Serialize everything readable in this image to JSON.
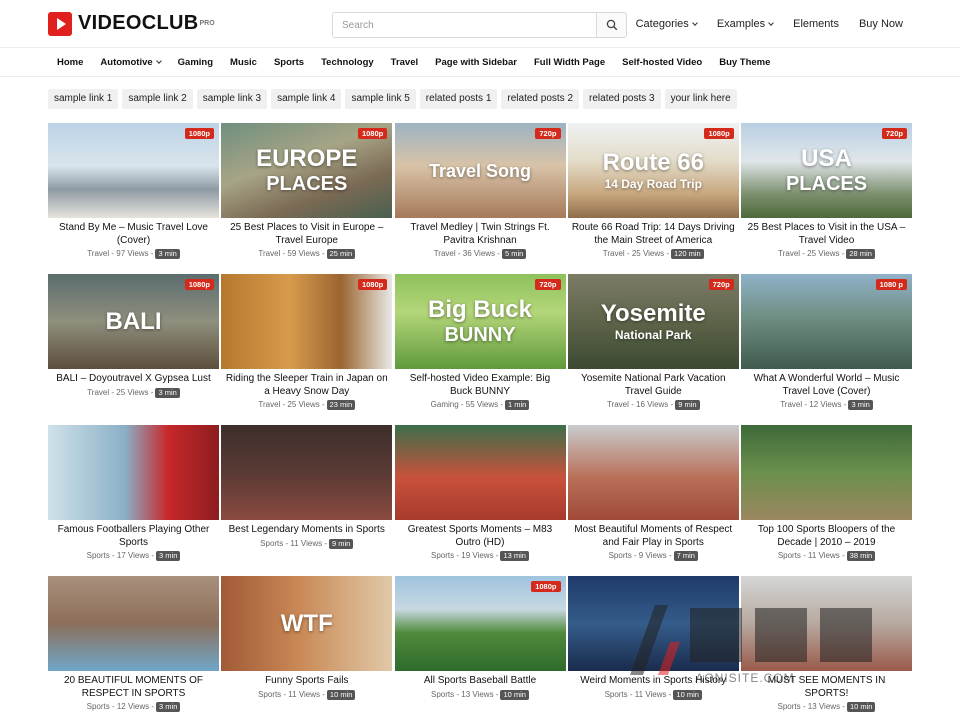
{
  "header": {
    "brand": "VIDEOCLUB",
    "brand_badge": "PRO",
    "search_placeholder": "Search",
    "menu": [
      {
        "label": "Categories",
        "dropdown": true
      },
      {
        "label": "Examples",
        "dropdown": true
      },
      {
        "label": "Elements",
        "dropdown": false
      },
      {
        "label": "Buy Now",
        "dropdown": false
      }
    ]
  },
  "nav": [
    {
      "label": "Home",
      "dropdown": false
    },
    {
      "label": "Automotive",
      "dropdown": true
    },
    {
      "label": "Gaming",
      "dropdown": false
    },
    {
      "label": "Music",
      "dropdown": false
    },
    {
      "label": "Sports",
      "dropdown": false
    },
    {
      "label": "Technology",
      "dropdown": false
    },
    {
      "label": "Travel",
      "dropdown": false
    },
    {
      "label": "Page with Sidebar",
      "dropdown": false
    },
    {
      "label": "Full Width Page",
      "dropdown": false
    },
    {
      "label": "Self-hosted Video",
      "dropdown": false
    },
    {
      "label": "Buy Theme",
      "dropdown": false
    }
  ],
  "tags": [
    "sample link 1",
    "sample link 2",
    "sample link 3",
    "sample link 4",
    "sample link 5",
    "related posts 1",
    "related posts 2",
    "related posts 3",
    "your link here"
  ],
  "videos": [
    {
      "title": "Stand By Me – Music Travel Love (Cover)",
      "meta": "Travel - 97 Views -",
      "duration": "3 min",
      "quality": "1080p",
      "thumb_text": "",
      "thumb_sub": "",
      "bg": "linear-gradient(180deg,#bcd3e6 0%,#d9e4ec 45%,#8e9aa3 70%,#e7e3dd 100%)"
    },
    {
      "title": "25 Best Places to Visit in Europe – Travel Europe",
      "meta": "Travel - 59 Views -",
      "duration": "25 min",
      "quality": "1080p",
      "thumb_text": "EUROPE",
      "thumb_sub": "PLACES",
      "bg": "linear-gradient(160deg,#6f8f7e 0%,#a7a486 40%,#7b6a54 70%,#48604f 100%)"
    },
    {
      "title": "Travel Medley | Twin Strings Ft. Pavitra Krishnan",
      "meta": "Travel - 36 Views -",
      "duration": "5 min",
      "quality": "720p",
      "thumb_text": "Travel Song",
      "thumb_sub": "",
      "bg": "linear-gradient(180deg,#9cb3c2 0%,#d8c3a8 45%,#a6795a 100%)"
    },
    {
      "title": "Route 66 Road Trip: 14 Days Driving the Main Street of America",
      "meta": "Travel - 25 Views -",
      "duration": "120 min",
      "quality": "1080p",
      "thumb_text": "Route 66",
      "thumb_sub": "14 Day Road Trip",
      "bg": "linear-gradient(180deg,#eef1f3 0%,#e3dcc9 40%,#c7a67d 75%,#8f6d4c 100%)"
    },
    {
      "title": "25 Best Places to Visit in the USA – Travel Video",
      "meta": "Travel - 25 Views -",
      "duration": "28 min",
      "quality": "720p",
      "thumb_text": "USA",
      "thumb_sub": "PLACES",
      "bg": "linear-gradient(180deg,#b8cfe3 0%,#e0e6ea 40%,#7c8f6e 75%,#4c6a3a 100%)"
    },
    {
      "title": "BALI – Doyoutravel X Gypsea Lust",
      "meta": "Travel - 25 Views -",
      "duration": "3 min",
      "quality": "1080p",
      "thumb_text": "BALI",
      "thumb_sub": "",
      "bg": "linear-gradient(180deg,#5b6d6e 0%,#8f8f7d 50%,#5c4e3d 100%)"
    },
    {
      "title": "Riding the Sleeper Train in Japan on a Heavy Snow Day",
      "meta": "Travel - 25 Views -",
      "duration": "23 min",
      "quality": "1080p",
      "thumb_text": "",
      "thumb_sub": "",
      "bg": "linear-gradient(90deg,#b5782d 0%,#d89b4d 40%,#9c6530 70%,#e8e8e6 100%)"
    },
    {
      "title": "Self-hosted Video Example: Big Buck BUNNY",
      "meta": "Gaming - 55 Views -",
      "duration": "1 min",
      "quality": "720p",
      "thumb_text": "Big Buck",
      "thumb_sub": "BUNNY",
      "bg": "linear-gradient(180deg,#8dc15b 0%,#b4d67a 40%,#5f9a3a 100%)"
    },
    {
      "title": "Yosemite National Park Vacation Travel Guide",
      "meta": "Travel - 16 Views -",
      "duration": "9 min",
      "quality": "720p",
      "thumb_text": "Yosemite",
      "thumb_sub": "National Park",
      "bg": "linear-gradient(180deg,#7d7b66 0%,#5d6449 50%,#3c4a32 100%)"
    },
    {
      "title": "What A Wonderful World – Music Travel Love (Cover)",
      "meta": "Travel - 12 Views -",
      "duration": "3 min",
      "quality": "1080 p",
      "thumb_text": "",
      "thumb_sub": "",
      "bg": "linear-gradient(180deg,#8fb2c9 0%,#6f8f82 45%,#3f5b4d 100%)"
    },
    {
      "title": "Famous Footballers Playing Other Sports",
      "meta": "Sports - 17 Views -",
      "duration": "3 min",
      "quality": "",
      "thumb_text": "",
      "thumb_sub": "",
      "bg": "linear-gradient(90deg,#cfe1ea 0%,#8ab0c6 45%,#c8282a 70%,#8d1d1f 100%)"
    },
    {
      "title": "Best Legendary Moments in Sports",
      "meta": "Sports - 11 Views -",
      "duration": "9 min",
      "quality": "",
      "thumb_text": "",
      "thumb_sub": "",
      "bg": "linear-gradient(180deg,#3c2f2b 0%,#5a3a34 50%,#8a4a3f 100%)"
    },
    {
      "title": "Greatest Sports Moments – M83 Outro (HD)",
      "meta": "Sports - 19 Views -",
      "duration": "13 min",
      "quality": "",
      "thumb_text": "",
      "thumb_sub": "",
      "bg": "linear-gradient(180deg,#3d6f4a 0%,#c8523c 55%,#a83a2c 100%)"
    },
    {
      "title": "Most Beautiful Moments of Respect and Fair Play in Sports",
      "meta": "Sports - 9 Views -",
      "duration": "7 min",
      "quality": "",
      "thumb_text": "",
      "thumb_sub": "",
      "bg": "linear-gradient(180deg,#c9ccce 0%,#b97058 55%,#a04a37 100%)"
    },
    {
      "title": "Top 100 Sports Bloopers of the Decade | 2010 – 2019",
      "meta": "Sports - 11 Views -",
      "duration": "38 min",
      "quality": "",
      "thumb_text": "",
      "thumb_sub": "",
      "bg": "linear-gradient(180deg,#3e6a3a 0%,#6b8f4c 50%,#9c8760 100%)"
    },
    {
      "title": "20 BEAUTIFUL MOMENTS OF RESPECT IN SPORTS",
      "meta": "Sports - 12 Views -",
      "duration": "3 min",
      "quality": "",
      "thumb_text": "",
      "thumb_sub": "",
      "bg": "linear-gradient(180deg,#a9907c 0%,#8c6f5b 50%,#6fa6c9 100%)"
    },
    {
      "title": "Funny Sports Fails",
      "meta": "Sports - 11 Views -",
      "duration": "10 min",
      "quality": "",
      "thumb_text": "WTF",
      "thumb_sub": "",
      "bg": "linear-gradient(90deg,#a15a36 0%,#c98855 45%,#e0c9a8 100%)"
    },
    {
      "title": "All Sports Baseball Battle",
      "meta": "Sports - 13 Views -",
      "duration": "10 min",
      "quality": "1080p",
      "thumb_text": "",
      "thumb_sub": "",
      "bg": "linear-gradient(180deg,#9fc3de 0%,#c7d8e2 35%,#4f8a3a 60%,#2f6b2c 100%)"
    },
    {
      "title": "Weird Moments in Sports History",
      "meta": "Sports - 11 Views -",
      "duration": "10 min",
      "quality": "",
      "thumb_text": "",
      "thumb_sub": "",
      "bg": "linear-gradient(180deg,#1e3a6a 0%,#355c8a 50%,#1a2c4d 100%)"
    },
    {
      "title": "MUST SEE MOMENTS IN SPORTS!",
      "meta": "Sports - 13 Views -",
      "duration": "10 min",
      "quality": "",
      "thumb_text": "",
      "thumb_sub": "",
      "bg": "linear-gradient(180deg,#d6d6d6 0%,#b7a9a0 50%,#9a5a4a 100%)"
    }
  ],
  "watermark": {
    "text": "AONISITE.COM"
  },
  "colors": {
    "brand": "#e0201c",
    "quality_badge": "#d42a1c",
    "duration_badge": "#555555"
  }
}
